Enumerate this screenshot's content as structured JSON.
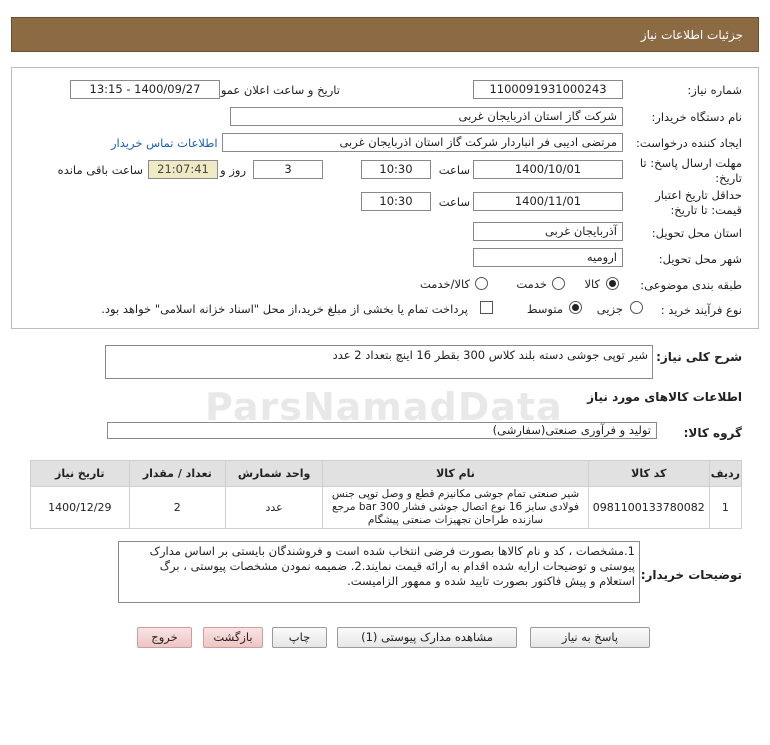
{
  "header": {
    "title": "جزئیات اطلاعات نیاز"
  },
  "info": {
    "need_number_label": "شماره نیاز:",
    "need_number": "1100091931000243",
    "announce_label": "تاریخ و ساعت اعلان عمومی:",
    "announce_value": "1400/09/27 - 13:15",
    "buyer_org_label": "نام دستگاه خریدار:",
    "buyer_org": "شرکت گاز استان اذربایجان غربی",
    "creator_label": "ایجاد کننده درخواست:",
    "creator": "مرتضی ادیبی فر انباردار شرکت گاز استان اذربایجان غربی",
    "contact_link": "اطلاعات تماس خریدار",
    "deadline_label_1": "مهلت ارسال پاسخ: تا",
    "deadline_label_2": "تاریخ:",
    "deadline_date": "1400/10/01",
    "time_label": "ساعت",
    "deadline_time": "10:30",
    "days_label": "روز و",
    "days": "3",
    "remaining_time": "21:07:41",
    "remaining_label": "ساعت باقی مانده",
    "validity_label_1": "حداقل تاریخ اعتبار",
    "validity_label_2": "قیمت: تا تاریخ:",
    "validity_date": "1400/11/01",
    "validity_time_label": "ساعت",
    "validity_time": "10:30",
    "province_label": "استان محل تحویل:",
    "province": "آذربایجان غربی",
    "city_label": "شهر محل تحویل:",
    "city": "ارومیه",
    "category_label": "طبقه بندی موضوعی:",
    "category_options": [
      "کالا",
      "خدمت",
      "کالا/خدمت"
    ],
    "process_label": "نوع فرآیند خرید :",
    "process_options": [
      "جزیی",
      "متوسط"
    ],
    "payment_note": "پرداخت تمام یا بخشی از مبلغ خرید،از محل \"اسناد خزانه اسلامی\" خواهد بود."
  },
  "summary": {
    "label": "شرح کلی نیاز:",
    "text": "شیر توپی جوشی دسته بلند کلاس 300 بقطر 16 اینچ بتعداد 2 عدد"
  },
  "goods": {
    "section_title": "اطلاعات کالاهای مورد نیاز",
    "group_label": "گروه کالا:",
    "group_value": "تولید و فرآوری صنعتی(سفارشی)",
    "columns": [
      "ردیف",
      "کد کالا",
      "نام کالا",
      "واحد شمارش",
      "تعداد / مقدار",
      "تاریخ نیاز"
    ],
    "rows": [
      {
        "row": "1",
        "code": "0981100133780082",
        "name": "شیر صنعتی تمام جوشی مکانیزم قطع و وصل توپی جنس فولادی سایز 16 نوع اتصال جوشی فشار 300 bar مرجع سازنده طراحان تجهیزات صنعتی پیشگام",
        "unit": "عدد",
        "qty": "2",
        "date": "1400/12/29"
      }
    ]
  },
  "buyer_notes": {
    "label": "توضیحات خریدار:",
    "text": "1.مشخصات ، کد و نام کالاها بصورت فرضی انتخاب شده است و فروشندگان بایستی بر اساس مدارک پیوستی و توضیحات ارایه شده اقدام به ارائه قیمت نمایند.2. ضمیمه نمودن مشخصات پیوستی ، برگ استعلام و پیش فاکتور بصورت تایید شده و ممهور الزامیست."
  },
  "buttons": {
    "respond": "پاسخ به نیاز",
    "attachments": "مشاهده مدارک پیوستی (1)",
    "print": "چاپ",
    "back": "بازگشت",
    "exit": "خروج"
  },
  "watermark": "ParsNamadData"
}
